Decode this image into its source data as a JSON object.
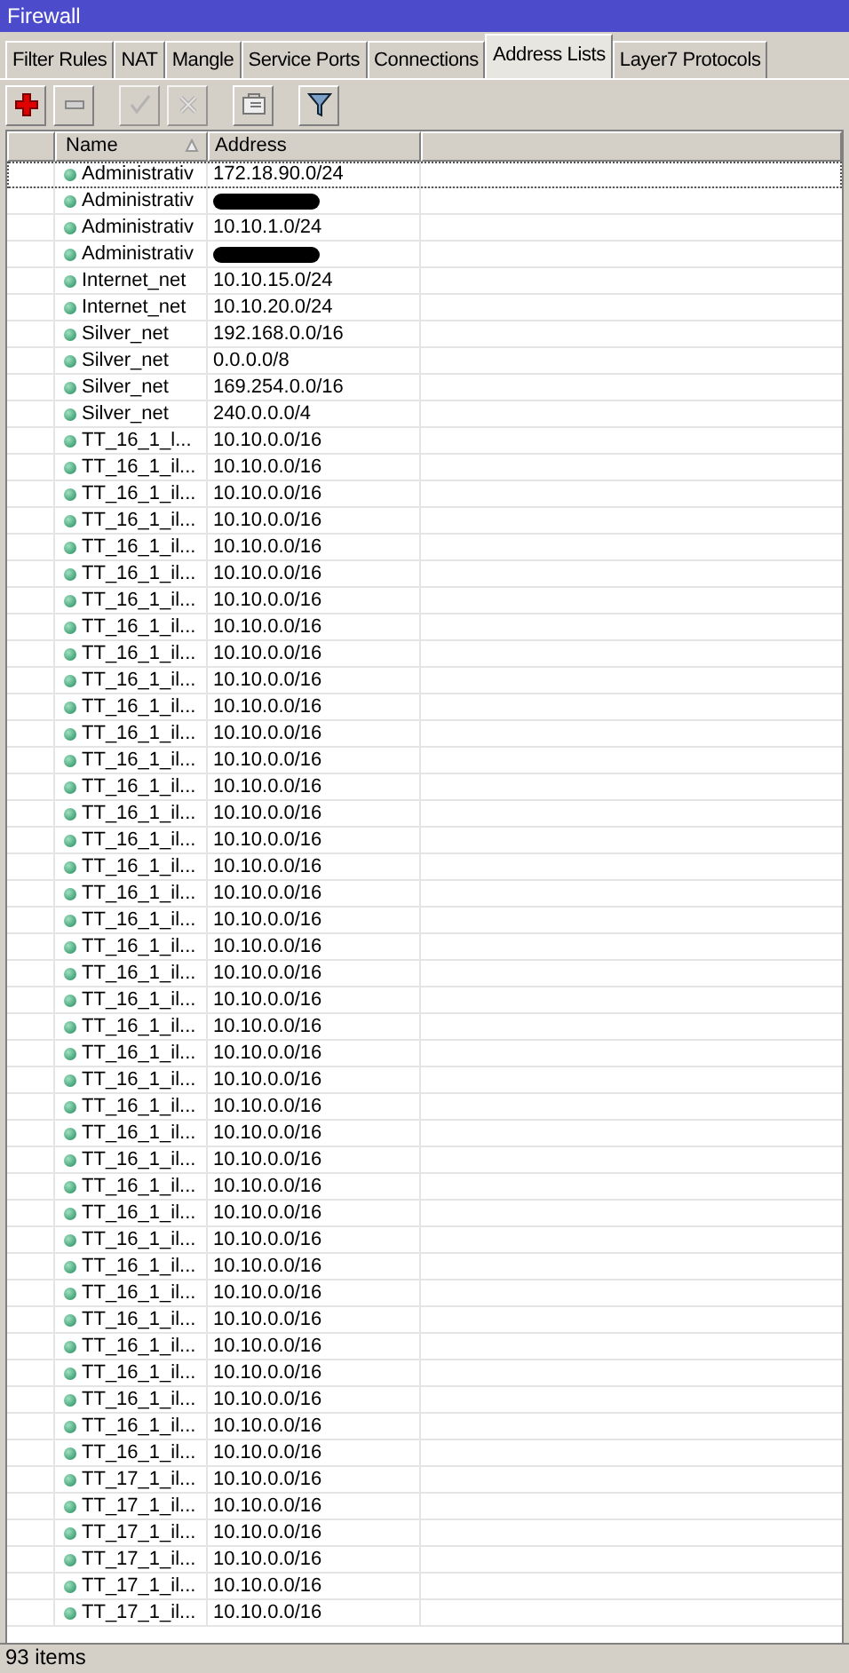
{
  "window": {
    "title": "Firewall"
  },
  "tabs": [
    {
      "label": "Filter Rules",
      "selected": false
    },
    {
      "label": "NAT",
      "selected": false
    },
    {
      "label": "Mangle",
      "selected": false
    },
    {
      "label": "Service Ports",
      "selected": false
    },
    {
      "label": "Connections",
      "selected": false
    },
    {
      "label": "Address Lists",
      "selected": true
    },
    {
      "label": "Layer7 Protocols",
      "selected": false
    }
  ],
  "toolbar": [
    {
      "kind": "add",
      "disabled": false
    },
    {
      "kind": "remove",
      "disabled": false
    },
    {
      "kind": "enable",
      "disabled": true
    },
    {
      "kind": "disable",
      "disabled": true
    },
    {
      "kind": "comment",
      "disabled": false
    },
    {
      "kind": "filter",
      "disabled": false
    }
  ],
  "table": {
    "columns": [
      "Name",
      "Address"
    ],
    "rows": [
      {
        "name": "Administrativ",
        "address": "172.18.90.0/24",
        "selected": true
      },
      {
        "name": "Administrativ",
        "redacted": true,
        "selected": false
      },
      {
        "name": "Administrativ",
        "address": "10.10.1.0/24",
        "selected": false
      },
      {
        "name": "Administrativ",
        "redacted": true,
        "selected": false
      },
      {
        "name": "Internet_net",
        "address": "10.10.15.0/24",
        "selected": false
      },
      {
        "name": "Internet_net",
        "address": "10.10.20.0/24",
        "selected": false
      },
      {
        "name": "Silver_net",
        "address": "192.168.0.0/16",
        "selected": false
      },
      {
        "name": "Silver_net",
        "address": "0.0.0.0/8",
        "selected": false
      },
      {
        "name": "Silver_net",
        "address": "169.254.0.0/16",
        "selected": false
      },
      {
        "name": "Silver_net",
        "address": "240.0.0.0/4",
        "selected": false
      },
      {
        "name": "TT_16_1_l...",
        "address": "10.10.0.0/16",
        "selected": false
      },
      {
        "name": "TT_16_1_il...",
        "address": "10.10.0.0/16",
        "selected": false
      },
      {
        "name": "TT_16_1_il...",
        "address": "10.10.0.0/16",
        "selected": false
      },
      {
        "name": "TT_16_1_il...",
        "address": "10.10.0.0/16",
        "selected": false
      },
      {
        "name": "TT_16_1_il...",
        "address": "10.10.0.0/16",
        "selected": false
      },
      {
        "name": "TT_16_1_il...",
        "address": "10.10.0.0/16",
        "selected": false
      },
      {
        "name": "TT_16_1_il...",
        "address": "10.10.0.0/16",
        "selected": false
      },
      {
        "name": "TT_16_1_il...",
        "address": "10.10.0.0/16",
        "selected": false
      },
      {
        "name": "TT_16_1_il...",
        "address": "10.10.0.0/16",
        "selected": false
      },
      {
        "name": "TT_16_1_il...",
        "address": "10.10.0.0/16",
        "selected": false
      },
      {
        "name": "TT_16_1_il...",
        "address": "10.10.0.0/16",
        "selected": false
      },
      {
        "name": "TT_16_1_il...",
        "address": "10.10.0.0/16",
        "selected": false
      },
      {
        "name": "TT_16_1_il...",
        "address": "10.10.0.0/16",
        "selected": false
      },
      {
        "name": "TT_16_1_il...",
        "address": "10.10.0.0/16",
        "selected": false
      },
      {
        "name": "TT_16_1_il...",
        "address": "10.10.0.0/16",
        "selected": false
      },
      {
        "name": "TT_16_1_il...",
        "address": "10.10.0.0/16",
        "selected": false
      },
      {
        "name": "TT_16_1_il...",
        "address": "10.10.0.0/16",
        "selected": false
      },
      {
        "name": "TT_16_1_il...",
        "address": "10.10.0.0/16",
        "selected": false
      },
      {
        "name": "TT_16_1_il...",
        "address": "10.10.0.0/16",
        "selected": false
      },
      {
        "name": "TT_16_1_il...",
        "address": "10.10.0.0/16",
        "selected": false
      },
      {
        "name": "TT_16_1_il...",
        "address": "10.10.0.0/16",
        "selected": false
      },
      {
        "name": "TT_16_1_il...",
        "address": "10.10.0.0/16",
        "selected": false
      },
      {
        "name": "TT_16_1_il...",
        "address": "10.10.0.0/16",
        "selected": false
      },
      {
        "name": "TT_16_1_il...",
        "address": "10.10.0.0/16",
        "selected": false
      },
      {
        "name": "TT_16_1_il...",
        "address": "10.10.0.0/16",
        "selected": false
      },
      {
        "name": "TT_16_1_il...",
        "address": "10.10.0.0/16",
        "selected": false
      },
      {
        "name": "TT_16_1_il...",
        "address": "10.10.0.0/16",
        "selected": false
      },
      {
        "name": "TT_16_1_il...",
        "address": "10.10.0.0/16",
        "selected": false
      },
      {
        "name": "TT_16_1_il...",
        "address": "10.10.0.0/16",
        "selected": false
      },
      {
        "name": "TT_16_1_il...",
        "address": "10.10.0.0/16",
        "selected": false
      },
      {
        "name": "TT_16_1_il...",
        "address": "10.10.0.0/16",
        "selected": false
      },
      {
        "name": "TT_16_1_il...",
        "address": "10.10.0.0/16",
        "selected": false
      },
      {
        "name": "TT_16_1_il...",
        "address": "10.10.0.0/16",
        "selected": false
      },
      {
        "name": "TT_16_1_il...",
        "address": "10.10.0.0/16",
        "selected": false
      },
      {
        "name": "TT_16_1_il...",
        "address": "10.10.0.0/16",
        "selected": false
      },
      {
        "name": "TT_16_1_il...",
        "address": "10.10.0.0/16",
        "selected": false
      },
      {
        "name": "TT_16_1_il...",
        "address": "10.10.0.0/16",
        "selected": false
      },
      {
        "name": "TT_16_1_il...",
        "address": "10.10.0.0/16",
        "selected": false
      },
      {
        "name": "TT_16_1_il...",
        "address": "10.10.0.0/16",
        "selected": false
      },
      {
        "name": "TT_17_1_il...",
        "address": "10.10.0.0/16",
        "selected": false
      },
      {
        "name": "TT_17_1_il...",
        "address": "10.10.0.0/16",
        "selected": false
      },
      {
        "name": "TT_17_1_il...",
        "address": "10.10.0.0/16",
        "selected": false
      },
      {
        "name": "TT_17_1_il...",
        "address": "10.10.0.0/16",
        "selected": false
      },
      {
        "name": "TT_17_1_il...",
        "address": "10.10.0.0/16",
        "selected": false
      },
      {
        "name": "TT_17_1_il...",
        "address": "10.10.0.0/16",
        "selected": false
      }
    ]
  },
  "status_bar": {
    "text": "93 items"
  }
}
